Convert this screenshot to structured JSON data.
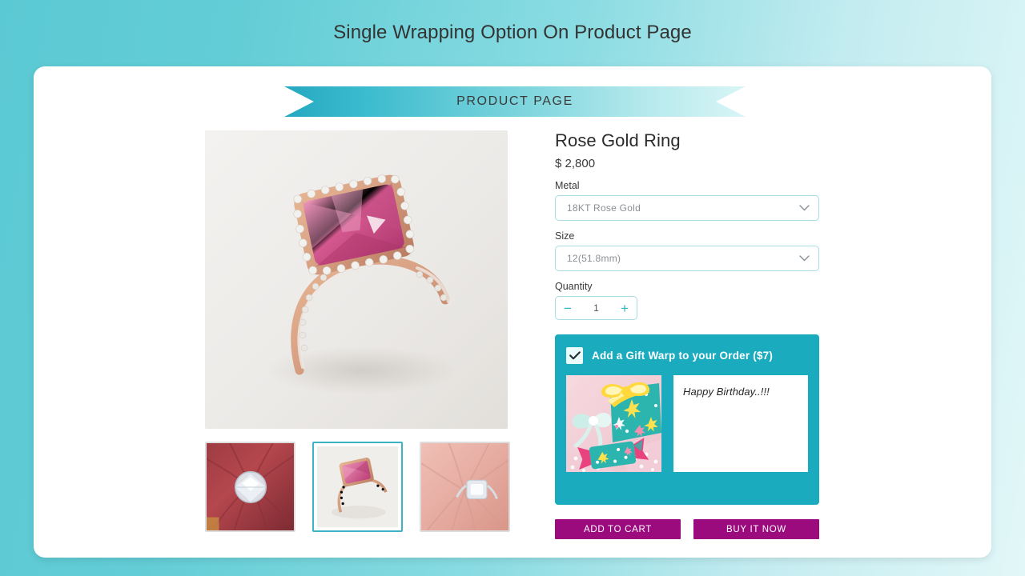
{
  "header": {
    "title": "Single Wrapping Option On Product Page"
  },
  "ribbon": {
    "label": "PRODUCT PAGE"
  },
  "gallery": {
    "hero_alt": "rose-gold-ring-pink-gemstone",
    "thumbnails": [
      {
        "alt": "diamond-ring-on-red-fabric",
        "selected": false
      },
      {
        "alt": "rose-gold-ring-pink-gemstone",
        "selected": true
      },
      {
        "alt": "diamond-ring-on-pink-fabric",
        "selected": false
      }
    ]
  },
  "product": {
    "title": "Rose Gold Ring",
    "price": "$ 2,800",
    "metal_label": "Metal",
    "metal_value": "18KT Rose Gold",
    "size_label": "Size",
    "size_value": "12(51.8mm)",
    "quantity_label": "Quantity",
    "quantity_value": "1",
    "decrement_label": "−",
    "increment_label": "+"
  },
  "giftwrap": {
    "checkbox_checked": true,
    "title": "Add a Gift Warp to your Order ($7)",
    "image_alt": "wrapped-gift-boxes-teal-paper",
    "note_value": "Happy Birthday..!!!",
    "note_placeholder": "Happy Birthday..!!!"
  },
  "actions": {
    "add_to_cart": "ADD TO CART",
    "buy_it_now": "BUY IT NOW"
  },
  "colors": {
    "background_start": "#5bc9d3",
    "background_end": "#e2f7f8",
    "ribbon_start": "#25a8c0",
    "ribbon_end": "#d9f5f6",
    "giftwrap_panel": "#1aabbf",
    "button": "#9b0b7e",
    "field_border": "#a9dce3",
    "accent_teal": "#2fb5c8",
    "selected_thumb_border": "#3cb4c6",
    "title_text": "#333333"
  }
}
